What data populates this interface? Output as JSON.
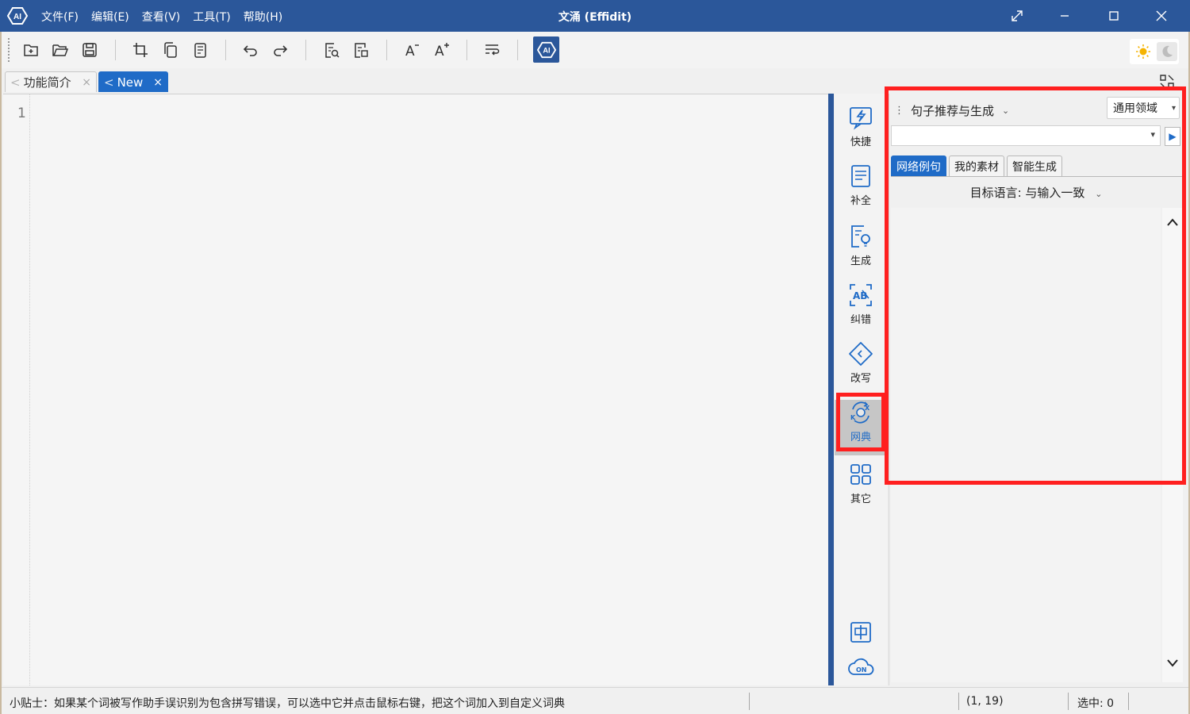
{
  "titlebar": {
    "menu": [
      "文件(F)",
      "编辑(E)",
      "查看(V)",
      "工具(T)",
      "帮助(H)"
    ],
    "title": "文涌 (Effidit)"
  },
  "tabs": [
    {
      "label": "功能简介",
      "arrow": "<",
      "close": "×",
      "active": false
    },
    {
      "label": "New",
      "arrow": "<",
      "close": "×",
      "active": true
    }
  ],
  "editor": {
    "line_number": "1"
  },
  "sidenav": {
    "items": [
      "快捷",
      "补全",
      "生成",
      "纠错",
      "改写",
      "网典",
      "其它"
    ],
    "active": "网典"
  },
  "panel": {
    "title": "句子推荐与生成",
    "domain": "通用领域",
    "query_value": "",
    "sub_tabs": [
      "网络例句",
      "我的素材",
      "智能生成"
    ],
    "target_lang_label": "目标语言:",
    "target_lang_value": "与输入一致"
  },
  "statusbar": {
    "tip": "小贴士：如果某个词被写作助手误识别为包含拼写错误，可以选中它并点击鼠标右键，把这个词加入到自定义词典",
    "position": "(1, 19)",
    "selection": "选中: 0"
  },
  "colors": {
    "accent": "#2b579a",
    "tab_active": "#1f6bc7",
    "highlight": "#ff1f1f"
  }
}
